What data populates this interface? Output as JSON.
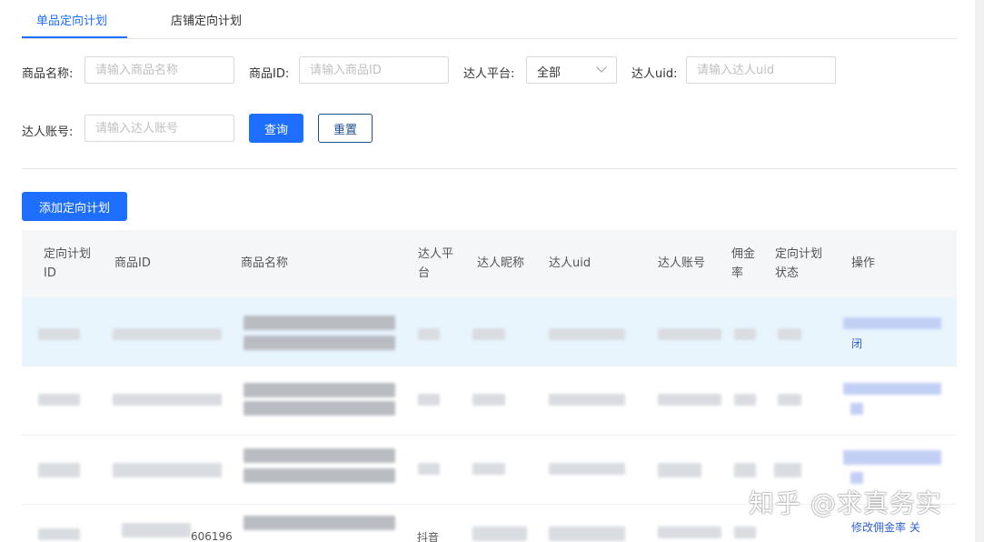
{
  "tabs": [
    {
      "label": "单品定向计划",
      "active": true
    },
    {
      "label": "店铺定向计划",
      "active": false
    }
  ],
  "filters": {
    "product_name": {
      "label": "商品名称:",
      "placeholder": "请输入商品名称",
      "value": ""
    },
    "product_id": {
      "label": "商品ID:",
      "placeholder": "请输入商品ID",
      "value": ""
    },
    "platform": {
      "label": "达人平台:",
      "value": "全部"
    },
    "talent_uid": {
      "label": "达人uid:",
      "placeholder": "请输入达人uid",
      "value": ""
    },
    "talent_account": {
      "label": "达人账号:",
      "placeholder": "请输入达人账号",
      "value": ""
    },
    "query_label": "查询",
    "reset_label": "重置"
  },
  "add_plan_label": "添加定向计划",
  "table": {
    "columns": [
      "定向计划ID",
      "商品ID",
      "商品名称",
      "达人平台",
      "达人昵称",
      "达人uid",
      "达人账号",
      "佣金率",
      "定向计划状态",
      "操作"
    ],
    "column_lines": [
      [
        "定向计划",
        "ID"
      ],
      [
        "商品ID"
      ],
      [
        "商品名称"
      ],
      [
        "达人平",
        "台"
      ],
      [
        "达人昵称"
      ],
      [
        "达人uid"
      ],
      [
        "达人账号"
      ],
      [
        "佣金",
        "率"
      ],
      [
        "定向计划",
        "状态"
      ],
      [
        "操作"
      ]
    ],
    "row1_op_tail": "闭",
    "row4_product_id_fragment": "606196",
    "row4_platform_fragment": "抖音",
    "row4_op_fragment": "修改佣金率 关"
  },
  "watermark": "知乎 @求真务实",
  "colors": {
    "primary": "#1e6fff",
    "highlight_row": "#e8f5fd",
    "header_bg": "#f5f6f8"
  }
}
